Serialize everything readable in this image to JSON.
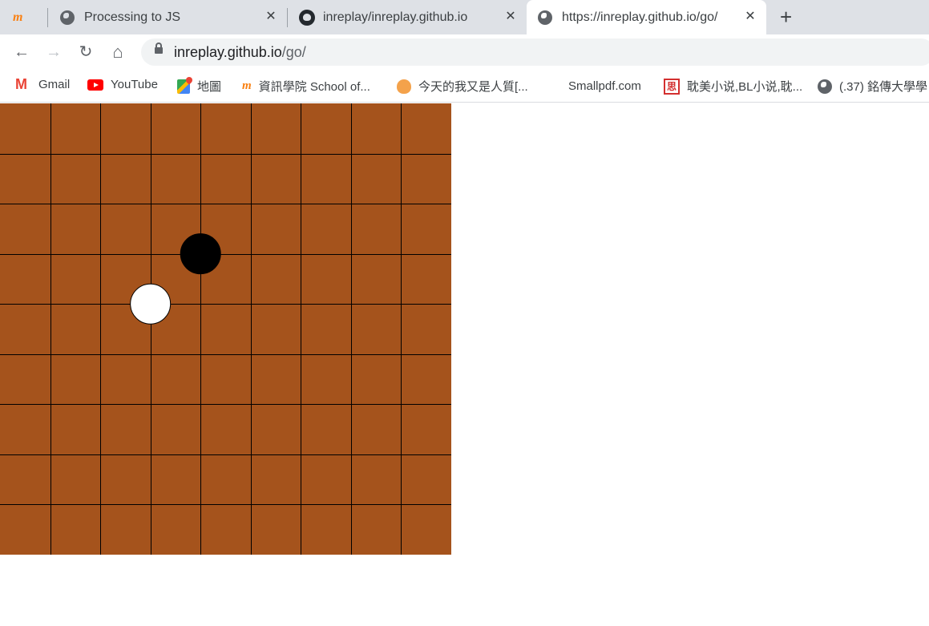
{
  "tabs": [
    {
      "label": "",
      "icon": "moodle-icon",
      "active": false
    },
    {
      "label": "Processing to JS",
      "icon": "globe-icon",
      "active": false
    },
    {
      "label": "inreplay/inreplay.github.io",
      "icon": "github-icon",
      "active": false
    },
    {
      "label": "https://inreplay.github.io/go/",
      "icon": "globe-icon",
      "active": true
    }
  ],
  "moodle_glyph": "m",
  "new_tab_symbol": "+",
  "close_symbol": "✕",
  "toolbar": {
    "back": "←",
    "forward": "→",
    "reload": "↻",
    "home": "⌂",
    "url_host": "inreplay.github.io",
    "url_path": "/go/"
  },
  "bookmarks": [
    {
      "label": "Gmail",
      "icon": "gmail-icon"
    },
    {
      "label": "YouTube",
      "icon": "youtube-icon"
    },
    {
      "label": "地圖",
      "icon": "maps-icon"
    },
    {
      "label": "資訊學院 School of...",
      "icon": "moodle-icon"
    },
    {
      "label": "今天的我又是人質[...",
      "icon": "fox-icon"
    },
    {
      "label": "Smallpdf.com",
      "icon": "smallpdf-icon"
    },
    {
      "label": "耽美小说,BL小说,耽...",
      "icon": "si-icon"
    },
    {
      "label": "(.37) 銘傳大學學",
      "icon": "globe-icon"
    }
  ],
  "si_glyph": "思",
  "board": {
    "grid_lines": 9,
    "cell_count": 9,
    "board_color": "#a5531c",
    "line_color": "#000000",
    "stones": [
      {
        "color": "black",
        "col": 4,
        "row": 3
      },
      {
        "color": "white",
        "col": 3,
        "row": 4
      }
    ]
  }
}
